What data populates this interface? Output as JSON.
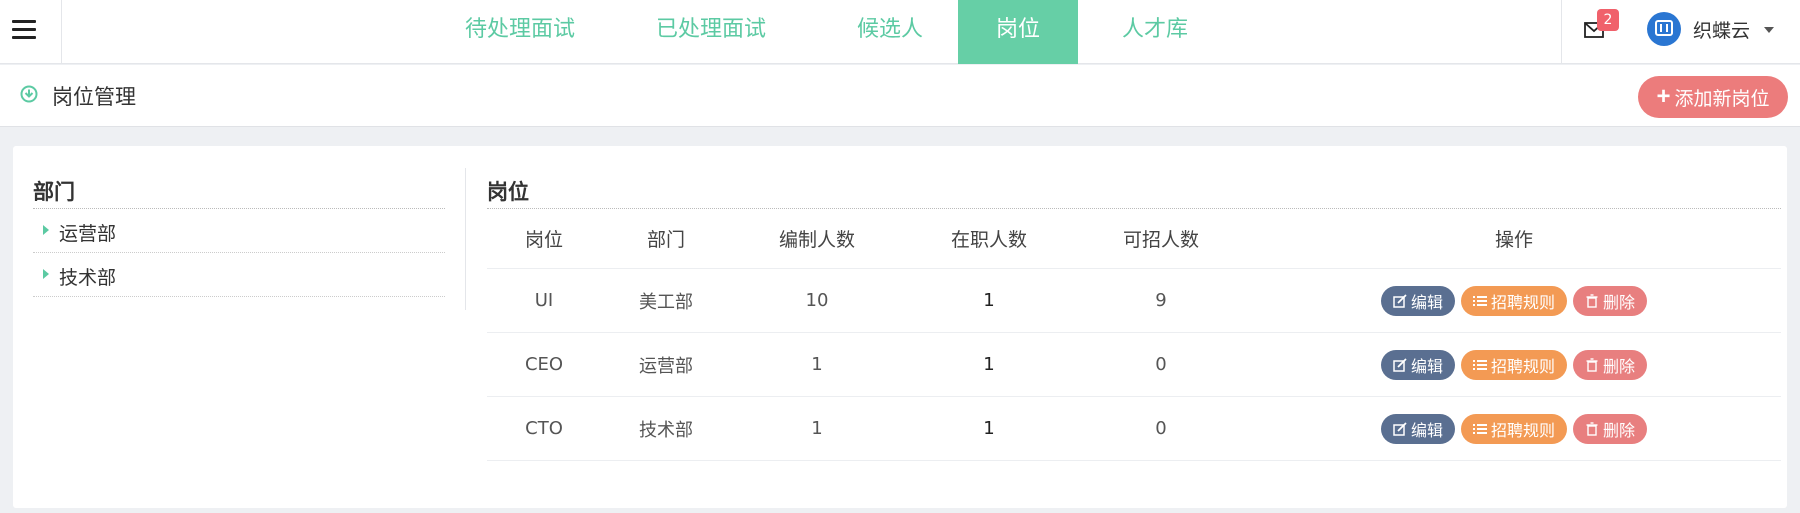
{
  "nav": {
    "tabs": [
      {
        "label": "待处理面试",
        "active": false
      },
      {
        "label": "已处理面试",
        "active": false
      },
      {
        "label": "候选人",
        "active": false
      },
      {
        "label": "岗位",
        "active": true
      },
      {
        "label": "人才库",
        "active": false
      }
    ],
    "mail_badge": "2",
    "user_name": "织蝶云"
  },
  "subheader": {
    "title": "岗位管理",
    "add_button": "添加新岗位"
  },
  "departments": {
    "title": "部门",
    "items": [
      "运营部",
      "技术部"
    ]
  },
  "jobs": {
    "title": "岗位",
    "columns": [
      "岗位",
      "部门",
      "编制人数",
      "在职人数",
      "可招人数",
      "操作"
    ],
    "rows": [
      {
        "job": "UI",
        "dept": "美工部",
        "quota": "10",
        "employed": "1",
        "open": "9"
      },
      {
        "job": "CEO",
        "dept": "运营部",
        "quota": "1",
        "employed": "1",
        "open": "0"
      },
      {
        "job": "CTO",
        "dept": "技术部",
        "quota": "1",
        "employed": "1",
        "open": "0"
      }
    ],
    "actions": {
      "edit": "编辑",
      "rules": "招聘规则",
      "delete": "删除"
    }
  },
  "colors": {
    "accent": "#66cfa6",
    "danger": "#ec7c7c",
    "edit": "#5a6f91",
    "rules": "#f39a54"
  }
}
